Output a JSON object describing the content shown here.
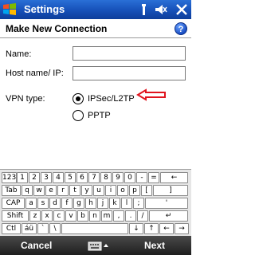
{
  "titlebar": {
    "title": "Settings",
    "icons": [
      "windows-start-icon",
      "signal-icon",
      "volume-icon",
      "close-icon"
    ]
  },
  "header": {
    "title": "Make New Connection",
    "help_icon": "?"
  },
  "form": {
    "name_label": "Name:",
    "name_value": "",
    "host_label": "Host name/ IP:",
    "host_value": "",
    "vpn_type_label": "VPN type:",
    "vpn_options": [
      "IPSec/L2TP",
      "PPTP"
    ],
    "vpn_selected": "IPSec/L2TP"
  },
  "keyboard": {
    "rows": [
      [
        "123",
        "1",
        "2",
        "3",
        "4",
        "5",
        "6",
        "7",
        "8",
        "9",
        "0",
        "-",
        "=",
        "←"
      ],
      [
        "Tab",
        "q",
        "w",
        "e",
        "r",
        "t",
        "y",
        "u",
        "i",
        "o",
        "p",
        "[",
        "]"
      ],
      [
        "CAP",
        "a",
        "s",
        "d",
        "f",
        "g",
        "h",
        "j",
        "k",
        "l",
        ";",
        "'"
      ],
      [
        "Shift",
        "z",
        "x",
        "c",
        "v",
        "b",
        "n",
        "m",
        ",",
        ".",
        "/",
        "↵"
      ],
      [
        "Ctl",
        "áü",
        "`",
        "\\",
        "",
        "↓",
        "↑",
        "←",
        "→"
      ]
    ]
  },
  "softkeys": {
    "left": "Cancel",
    "right": "Next",
    "center_icon": "keyboard-icon"
  },
  "colors": {
    "titlebar": "#1650b8",
    "softbar": "#2a2a2a",
    "arrow": "#e0141e"
  }
}
